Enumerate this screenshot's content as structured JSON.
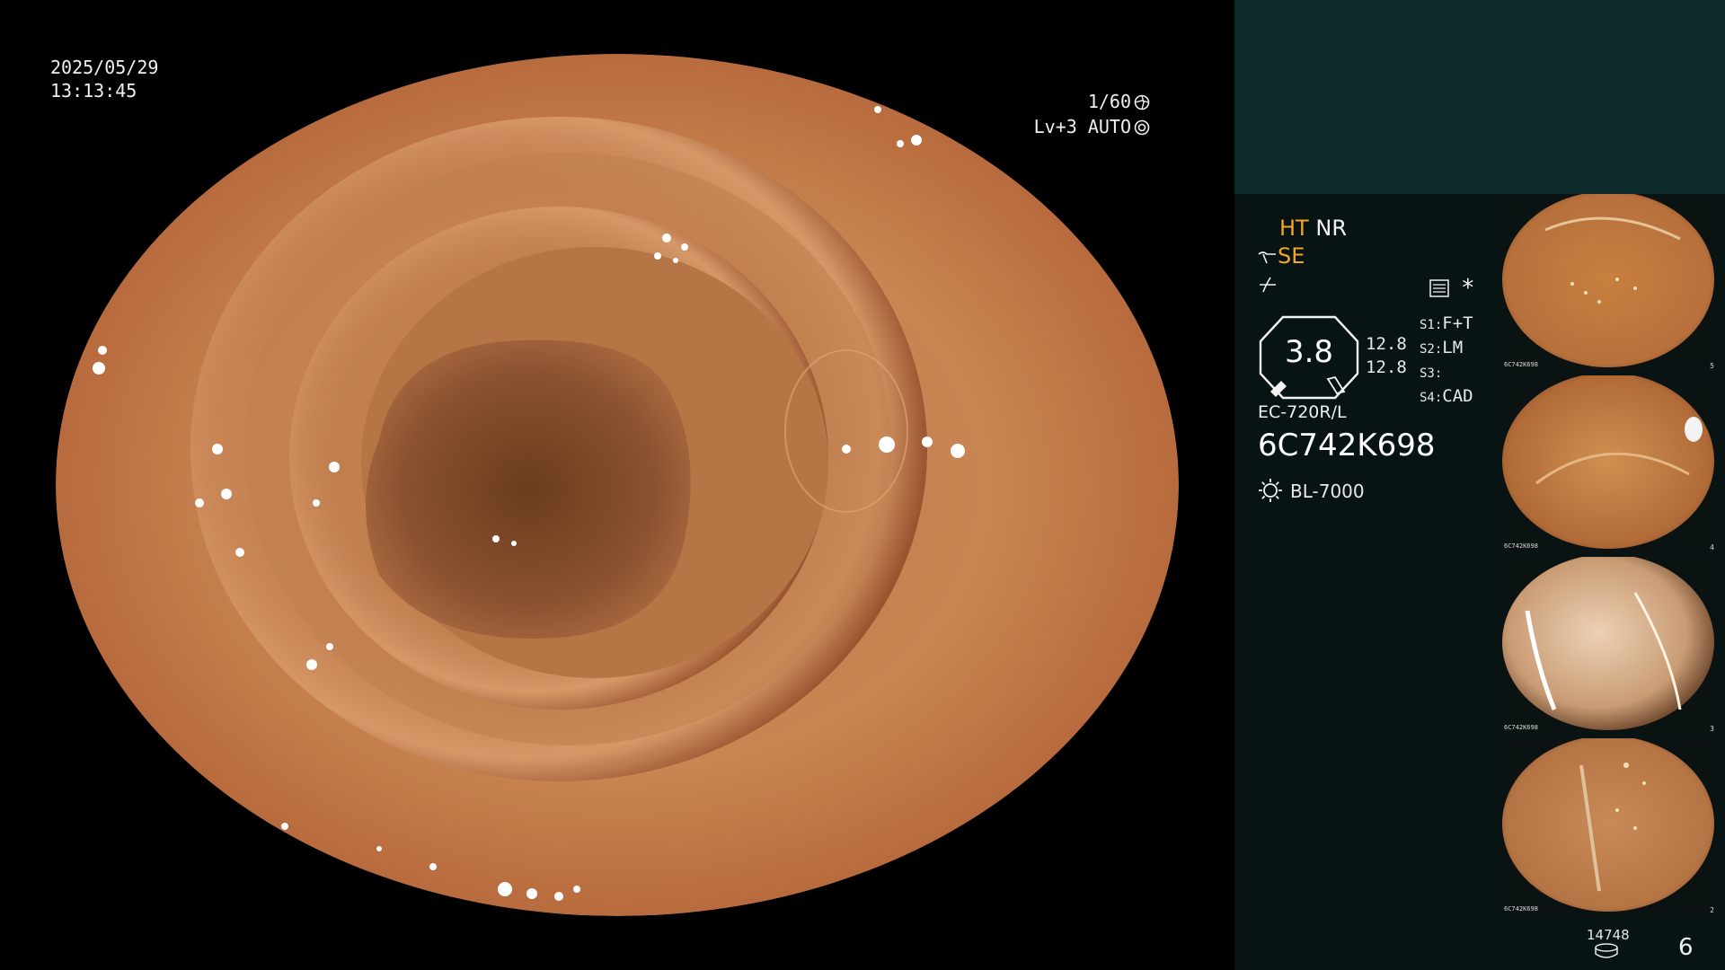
{
  "osd": {
    "date": "2025/05/29",
    "time": "13:13:45",
    "shutter": "1/60",
    "brightness": "Lv+3 AUTO"
  },
  "status": {
    "mode_ht": "HT",
    "mode_nr": "NR",
    "mode_se": "SE",
    "gauge_value": "3.8",
    "level_1": "12.8",
    "level_2": "12.8",
    "slots": [
      {
        "key": "S1:",
        "value": "F+T"
      },
      {
        "key": "S2:",
        "value": "LM"
      },
      {
        "key": "S3:",
        "value": ""
      },
      {
        "key": "S4:",
        "value": "CAD"
      }
    ],
    "scope_model": "EC-720R/L",
    "scope_serial": "6C742K698",
    "light_source": "BL-7000"
  },
  "thumbnails": [
    {
      "serial": "6C742K698",
      "index": "5"
    },
    {
      "serial": "6C742K698",
      "index": "4"
    },
    {
      "serial": "6C742K698",
      "index": "3"
    },
    {
      "serial": "6C742K698",
      "index": "2"
    }
  ],
  "footer": {
    "counter": "14748",
    "page": "6"
  },
  "colors": {
    "accent": "#f5a623",
    "panel_bg": "#081414",
    "panel_top": "#0c2a2a"
  }
}
